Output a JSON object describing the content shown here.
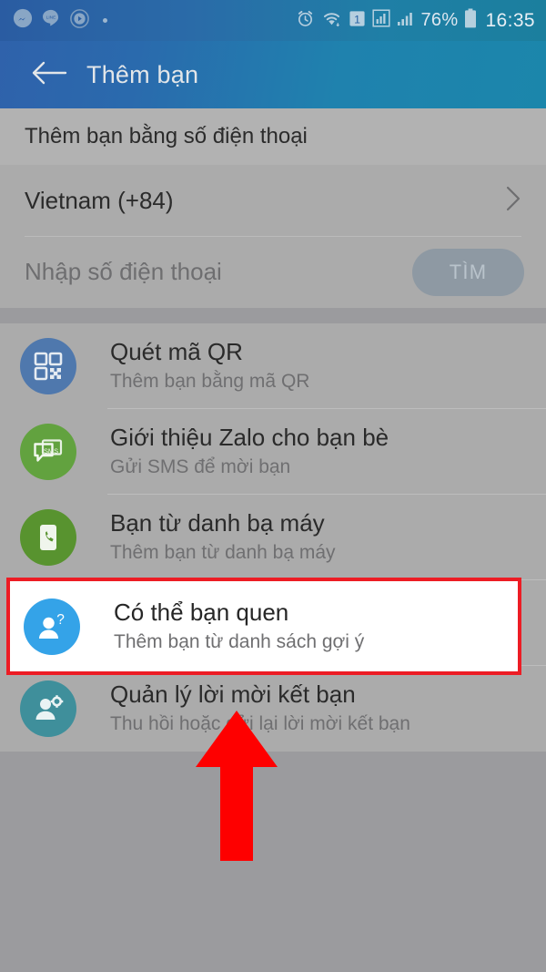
{
  "statusbar": {
    "left_icons": [
      "messenger-icon",
      "line-icon",
      "play-circle-icon",
      "small-dot-icon"
    ],
    "right_icons": [
      "alarm-icon",
      "wifi-icon",
      "sim-1-icon",
      "signal-icon",
      "signal-bars-icon",
      "battery-icon"
    ],
    "sim_label": "1",
    "battery_percent": "76%",
    "time": "16:35"
  },
  "appbar": {
    "back_icon": "back-arrow-icon",
    "title": "Thêm bạn"
  },
  "section_header": {
    "label": "Thêm bạn bằng số điện thoại"
  },
  "phone_section": {
    "country": "Vietnam (+84)",
    "chevron_icon": "chevron-right-icon",
    "phone_placeholder": "Nhập số điện thoại",
    "phone_value": "",
    "find_button": "TÌM"
  },
  "list": {
    "items": [
      {
        "icon": "qr-code-icon",
        "icon_color": "#4f78ad",
        "title": "Quét mã QR",
        "subtitle": "Thêm bạn bằng mã QR",
        "highlighted": false
      },
      {
        "icon": "sms-bubble-icon",
        "icon_color": "#62a23f",
        "title": "Giới thiệu Zalo cho bạn bè",
        "subtitle": "Gửi SMS để mời bạn",
        "highlighted": false
      },
      {
        "icon": "phone-contact-icon",
        "icon_color": "#58932f",
        "title": "Bạn từ danh bạ máy",
        "subtitle": "Thêm bạn từ danh bạ máy",
        "highlighted": false
      },
      {
        "icon": "person-question-icon",
        "icon_color": "#34a3e8",
        "title": "Có thể bạn quen",
        "subtitle": "Thêm bạn từ danh sách gợi ý",
        "highlighted": true
      },
      {
        "icon": "person-gear-icon",
        "icon_color": "#3f8f9b",
        "title": "Quản lý lời mời kết bạn",
        "subtitle": "Thu hồi hoặc gửi lại lời mời kết bạn",
        "highlighted": false
      }
    ]
  },
  "annotations": {
    "highlight_color": "#ed1c24",
    "arrow_color": "#fe0000",
    "arrow_icon": "up-arrow-annotation-icon",
    "highlight_target": "Có thể bạn quen"
  }
}
